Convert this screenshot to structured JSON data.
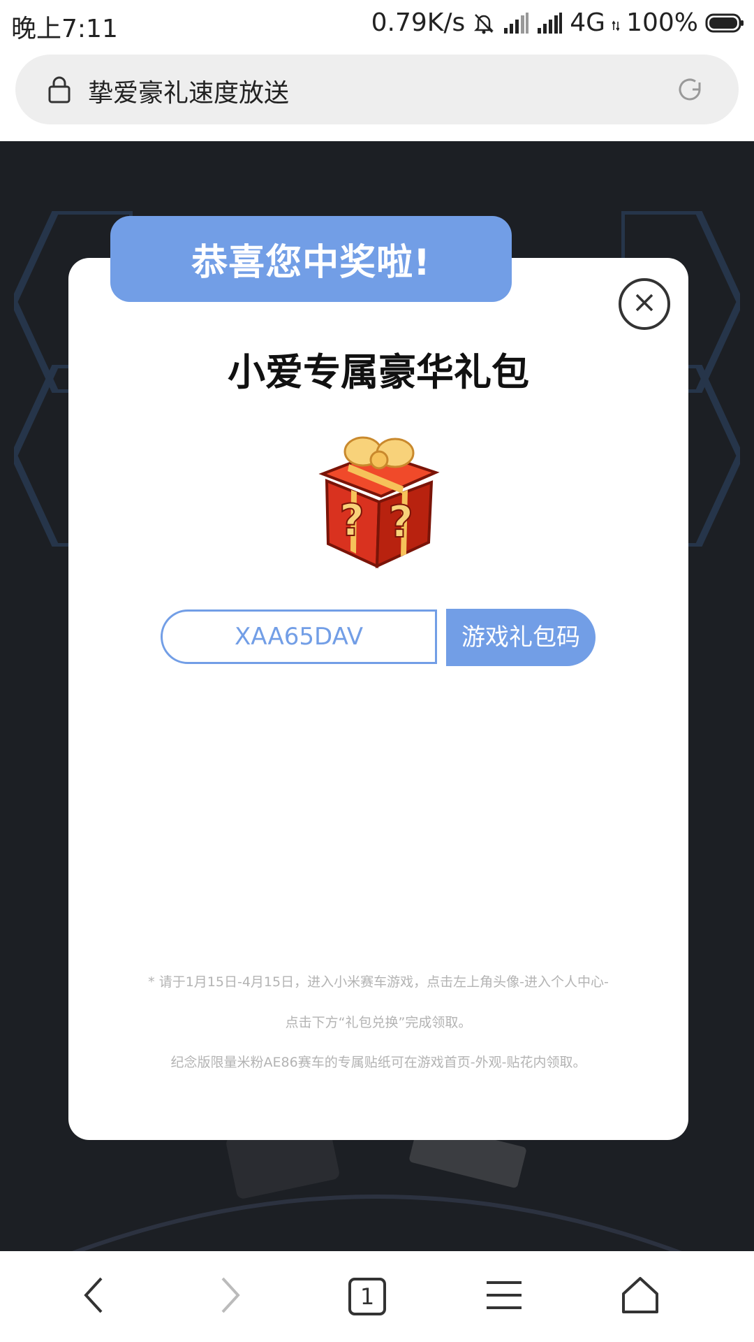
{
  "status_bar": {
    "time": "晚上7:11",
    "net_speed": "0.79K/s",
    "network": "4G",
    "battery": "100%"
  },
  "browser": {
    "page_title": "挚爱豪礼速度放送",
    "tab_count": "1"
  },
  "modal": {
    "ribbon_text": "恭喜您中奖啦!",
    "heading": "小爱专属豪华礼包",
    "code_value": "XAA65DAV",
    "code_button": "游戏礼包码",
    "notes": [
      "* 请于1月15日-4月15日，进入小米赛车游戏，点击左上角头像-进入个人中心-",
      "点击下方“礼包兑换”完成领取。",
      "纪念版限量米粉AE86赛车的专属贴纸可在游戏首页-外观-贴花内领取。"
    ]
  },
  "colors": {
    "accent": "#729ee6",
    "page_background": "#1c1f24",
    "note_text": "#b3b3b3"
  },
  "icons": {
    "lock": "lock-icon",
    "reload": "reload-icon",
    "close": "close-icon",
    "gift": "gift-icon",
    "back": "back-icon",
    "forward": "forward-icon",
    "menu": "menu-icon",
    "home": "home-icon"
  }
}
